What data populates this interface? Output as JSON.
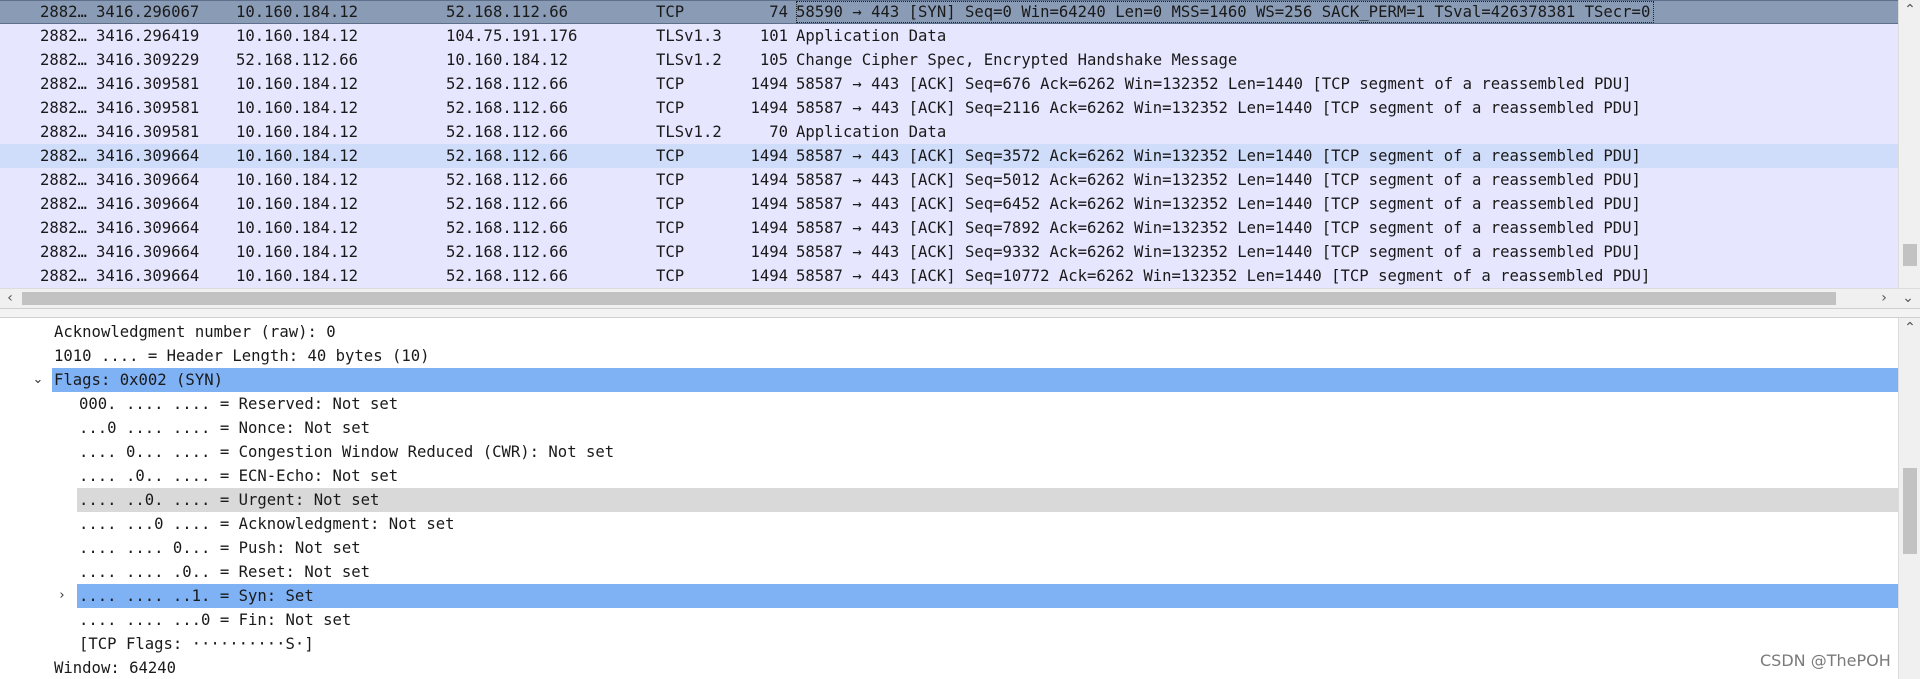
{
  "packet_list": {
    "rows": [
      {
        "no": "2882…",
        "time": "3416.296067",
        "src": "10.160.184.12",
        "dst": "52.168.112.66",
        "proto": "TCP",
        "len": "74",
        "info": "58590 → 443 [SYN] Seq=0 Win=64240 Len=0 MSS=1460 WS=256 SACK_PERM=1 TSval=426378381 TSecr=0",
        "state": "selected"
      },
      {
        "no": "2882…",
        "time": "3416.296419",
        "src": "10.160.184.12",
        "dst": "104.75.191.176",
        "proto": "TLSv1.3",
        "len": "101",
        "info": "Application Data",
        "state": ""
      },
      {
        "no": "2882…",
        "time": "3416.309229",
        "src": "52.168.112.66",
        "dst": "10.160.184.12",
        "proto": "TLSv1.2",
        "len": "105",
        "info": "Change Cipher Spec, Encrypted Handshake Message",
        "state": ""
      },
      {
        "no": "2882…",
        "time": "3416.309581",
        "src": "10.160.184.12",
        "dst": "52.168.112.66",
        "proto": "TCP",
        "len": "1494",
        "info": "58587 → 443 [ACK] Seq=676 Ack=6262 Win=132352 Len=1440 [TCP segment of a reassembled PDU]",
        "state": ""
      },
      {
        "no": "2882…",
        "time": "3416.309581",
        "src": "10.160.184.12",
        "dst": "52.168.112.66",
        "proto": "TCP",
        "len": "1494",
        "info": "58587 → 443 [ACK] Seq=2116 Ack=6262 Win=132352 Len=1440 [TCP segment of a reassembled PDU]",
        "state": ""
      },
      {
        "no": "2882…",
        "time": "3416.309581",
        "src": "10.160.184.12",
        "dst": "52.168.112.66",
        "proto": "TLSv1.2",
        "len": "70",
        "info": "Application Data",
        "state": ""
      },
      {
        "no": "2882…",
        "time": "3416.309664",
        "src": "10.160.184.12",
        "dst": "52.168.112.66",
        "proto": "TCP",
        "len": "1494",
        "info": "58587 → 443 [ACK] Seq=3572 Ack=6262 Win=132352 Len=1440 [TCP segment of a reassembled PDU]",
        "state": "hover"
      },
      {
        "no": "2882…",
        "time": "3416.309664",
        "src": "10.160.184.12",
        "dst": "52.168.112.66",
        "proto": "TCP",
        "len": "1494",
        "info": "58587 → 443 [ACK] Seq=5012 Ack=6262 Win=132352 Len=1440 [TCP segment of a reassembled PDU]",
        "state": ""
      },
      {
        "no": "2882…",
        "time": "3416.309664",
        "src": "10.160.184.12",
        "dst": "52.168.112.66",
        "proto": "TCP",
        "len": "1494",
        "info": "58587 → 443 [ACK] Seq=6452 Ack=6262 Win=132352 Len=1440 [TCP segment of a reassembled PDU]",
        "state": ""
      },
      {
        "no": "2882…",
        "time": "3416.309664",
        "src": "10.160.184.12",
        "dst": "52.168.112.66",
        "proto": "TCP",
        "len": "1494",
        "info": "58587 → 443 [ACK] Seq=7892 Ack=6262 Win=132352 Len=1440 [TCP segment of a reassembled PDU]",
        "state": ""
      },
      {
        "no": "2882…",
        "time": "3416.309664",
        "src": "10.160.184.12",
        "dst": "52.168.112.66",
        "proto": "TCP",
        "len": "1494",
        "info": "58587 → 443 [ACK] Seq=9332 Ack=6262 Win=132352 Len=1440 [TCP segment of a reassembled PDU]",
        "state": ""
      },
      {
        "no": "2882…",
        "time": "3416.309664",
        "src": "10.160.184.12",
        "dst": "52.168.112.66",
        "proto": "TCP",
        "len": "1494",
        "info": "58587 → 443 [ACK] Seq=10772 Ack=6262 Win=132352 Len=1440 [TCP segment of a reassembled PDU]",
        "state": ""
      }
    ]
  },
  "details": {
    "rows": [
      {
        "text": "Acknowledgment number (raw): 0",
        "level": 0,
        "expander": "",
        "state": ""
      },
      {
        "text": "1010 .... = Header Length: 40 bytes (10)",
        "level": 0,
        "expander": "",
        "state": ""
      },
      {
        "text": "Flags: 0x002 (SYN)",
        "level": 0,
        "expander": "⌄",
        "state": "sel"
      },
      {
        "text": "000. .... .... = Reserved: Not set",
        "level": 1,
        "expander": "",
        "state": ""
      },
      {
        "text": "...0 .... .... = Nonce: Not set",
        "level": 1,
        "expander": "",
        "state": ""
      },
      {
        "text": ".... 0... .... = Congestion Window Reduced (CWR): Not set",
        "level": 1,
        "expander": "",
        "state": ""
      },
      {
        "text": ".... .0.. .... = ECN-Echo: Not set",
        "level": 1,
        "expander": "",
        "state": ""
      },
      {
        "text": ".... ..0. .... = Urgent: Not set",
        "level": 1,
        "expander": "",
        "state": "hl"
      },
      {
        "text": ".... ...0 .... = Acknowledgment: Not set",
        "level": 1,
        "expander": "",
        "state": ""
      },
      {
        "text": ".... .... 0... = Push: Not set",
        "level": 1,
        "expander": "",
        "state": ""
      },
      {
        "text": ".... .... .0.. = Reset: Not set",
        "level": 1,
        "expander": "",
        "state": ""
      },
      {
        "text": ".... .... ..1. = Syn: Set",
        "level": 1,
        "expander": "›",
        "state": "sel"
      },
      {
        "text": ".... .... ...0 = Fin: Not set",
        "level": 1,
        "expander": "",
        "state": ""
      },
      {
        "text": "[TCP Flags: ··········S·]",
        "level": 1,
        "expander": "",
        "state": ""
      },
      {
        "text": "Window: 64240",
        "level": 0,
        "expander": "",
        "state": ""
      }
    ]
  },
  "scroll_arrows": {
    "left": "‹",
    "right": "›",
    "up": "⌃",
    "down": "⌄"
  },
  "watermark": "CSDN @ThePOH"
}
